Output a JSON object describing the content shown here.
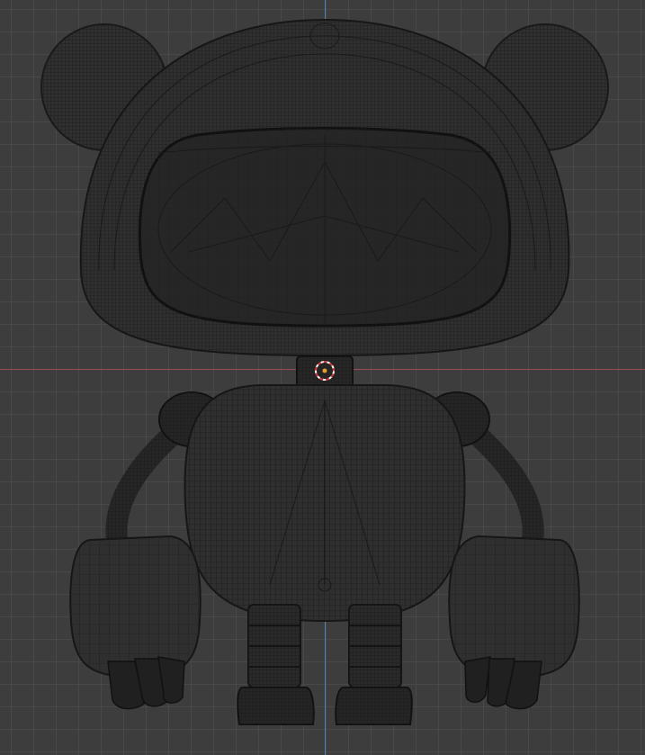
{
  "viewport": {
    "background": "#3d3d3d",
    "grid_color": "#484848",
    "axis_x_color": "#9b4a52",
    "axis_y_color": "#4d7fb8",
    "wire_color": "#1a1a1a",
    "mesh_fill": "#303030",
    "mesh_fill_dark": "#262626"
  },
  "scene": {
    "object": "wireframe-robot-model",
    "parts": [
      "head",
      "ear-left",
      "ear-right",
      "visor",
      "neck",
      "body",
      "arm-left",
      "arm-right",
      "hand-left",
      "hand-right",
      "leg-left",
      "leg-right",
      "foot-left",
      "foot-right"
    ],
    "origin_marker": "3d-cursor-icon"
  }
}
